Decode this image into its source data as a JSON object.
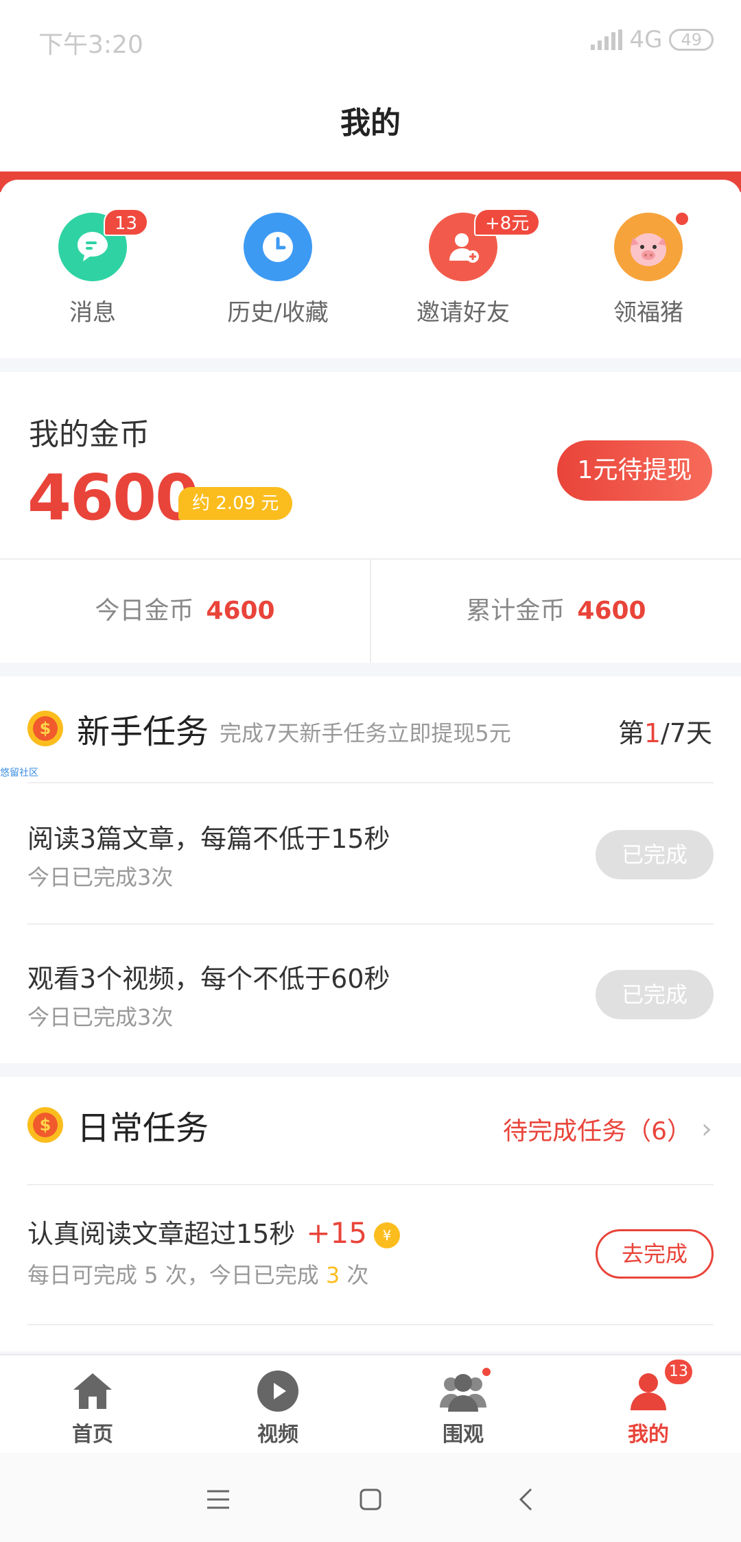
{
  "status_bar": {
    "time": "下午3:20",
    "network": "4G",
    "battery": "49"
  },
  "header": {
    "title": "我的"
  },
  "quick_actions": [
    {
      "label": "消息",
      "badge": "13",
      "icon": "message-icon",
      "color": "#2fd3a3"
    },
    {
      "label": "历史/收藏",
      "badge": "",
      "icon": "clock-icon",
      "color": "#3d9af3"
    },
    {
      "label": "邀请好友",
      "badge": "+8元",
      "icon": "add-user-icon",
      "color": "#f25b4b"
    },
    {
      "label": "领福猪",
      "badge": "",
      "icon": "pig-icon",
      "color": "#f7a33b"
    }
  ],
  "coins": {
    "title": "我的金币",
    "amount": "4600",
    "approx": "约 2.09 元",
    "withdraw_label": "1元待提现",
    "today_label": "今日金币",
    "today_value": "4600",
    "total_label": "累计金币",
    "total_value": "4600"
  },
  "newbie_tasks": {
    "title": "新手任务",
    "subtitle": "完成7天新手任务立即提现5元",
    "day_prefix": "第",
    "day_current": "1",
    "day_suffix": "/7天",
    "watermark": "悠留社区",
    "items": [
      {
        "title": "阅读3篇文章，每篇不低于15秒",
        "sub": "今日已完成3次",
        "button": "已完成"
      },
      {
        "title": "观看3个视频，每个不低于60秒",
        "sub": "今日已完成3次",
        "button": "已完成"
      }
    ]
  },
  "daily_tasks": {
    "title": "日常任务",
    "pending": "待完成任务（6）",
    "items": [
      {
        "title": "认真阅读文章超过15秒",
        "reward": "+15",
        "coin_symbol": "¥",
        "sub_prefix": "每日可完成 5 次，今日已完成 ",
        "sub_count": "3",
        "sub_suffix": " 次",
        "button": "去完成"
      }
    ]
  },
  "tabbar": [
    {
      "label": "首页",
      "icon": "home-icon",
      "active": false
    },
    {
      "label": "视频",
      "icon": "play-icon",
      "active": false
    },
    {
      "label": "围观",
      "icon": "group-icon",
      "active": false
    },
    {
      "label": "我的",
      "icon": "person-icon",
      "active": true,
      "badge": "13"
    }
  ],
  "colors": {
    "accent": "#e9443a",
    "gold": "#fbbd1e"
  }
}
